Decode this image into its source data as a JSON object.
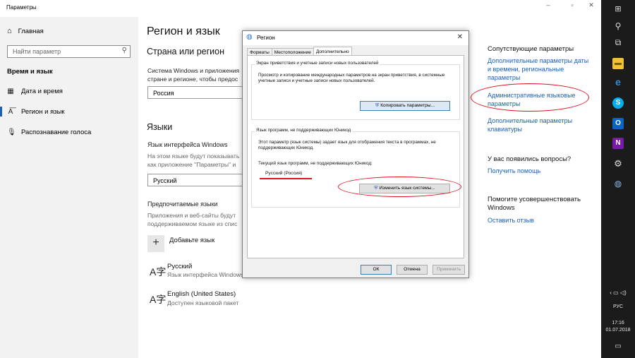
{
  "window": {
    "title": "Параметры",
    "minimize": "–",
    "maximize": "▫",
    "close": "✕"
  },
  "sidebar": {
    "home": "Главная",
    "search_placeholder": "Найти параметр",
    "section": "Время и язык",
    "items": [
      {
        "label": "Дата и время",
        "icon": "calendar-icon"
      },
      {
        "label": "Регион и язык",
        "icon": "language-icon"
      },
      {
        "label": "Распознавание голоса",
        "icon": "microphone-icon"
      }
    ]
  },
  "main": {
    "title": "Регион и язык",
    "country_heading": "Страна или регион",
    "country_desc": "Система Windows и приложения\nстране и регионе, чтобы предос",
    "country_value": "Россия",
    "languages_heading": "Языки",
    "ui_lang_label": "Язык интерфейса Windows",
    "ui_lang_desc": "На этом языке будут показывать\nкак приложение \"Параметры\" и",
    "ui_lang_value": "Русский",
    "preferred_label": "Предпочитаемые языки",
    "preferred_desc": "Приложения и веб-сайты будут\nподдерживаемом языке из спис",
    "add_language": "Добавьте язык",
    "languages": [
      {
        "name": "Русский",
        "sub": "Язык интерфейса Windows"
      },
      {
        "name": "English (United States)",
        "sub": "Доступен языковой пакет"
      }
    ]
  },
  "related": {
    "heading": "Сопутствующие параметры",
    "links": [
      "Дополнительные параметры даты и времени, региональные параметры",
      "Административные языковые параметры",
      "Дополнительные параметры клавиатуры"
    ],
    "questions_heading": "У вас появились вопросы?",
    "help_link": "Получить помощь",
    "improve_heading": "Помогите усовершенствовать Windows",
    "feedback_link": "Оставить отзыв"
  },
  "dialog": {
    "title": "Регион",
    "tabs": [
      "Форматы",
      "Местоположение",
      "Дополнительно"
    ],
    "active_tab": 2,
    "group1": {
      "title": "Экран приветствия и учетные записи новых пользователей",
      "text": "Просмотр и копирование международных параметров на экран приветствия, в системные учетные записи и учетные записи новых пользователей.",
      "button": "Копировать параметры..."
    },
    "group2": {
      "title": "Язык программ, не поддерживающих Юникод",
      "text": "Этот параметр (язык системы) задает язык для отображения текста в программах, не поддерживающих Юникод.",
      "current_label": "Текущий язык программ, не поддерживающих Юникод:",
      "current_value": "Русский (Россия)",
      "button": "Изменить язык системы..."
    },
    "ok": "ОК",
    "cancel": "Отмена",
    "apply": "Применить"
  },
  "taskbar": {
    "lang": "РУС",
    "time": "17:16",
    "date": "01.07.2018"
  },
  "colors": {
    "link": "#1a5fb4",
    "annotation": "#e3101f",
    "taskbar": "#1b1b1b"
  }
}
